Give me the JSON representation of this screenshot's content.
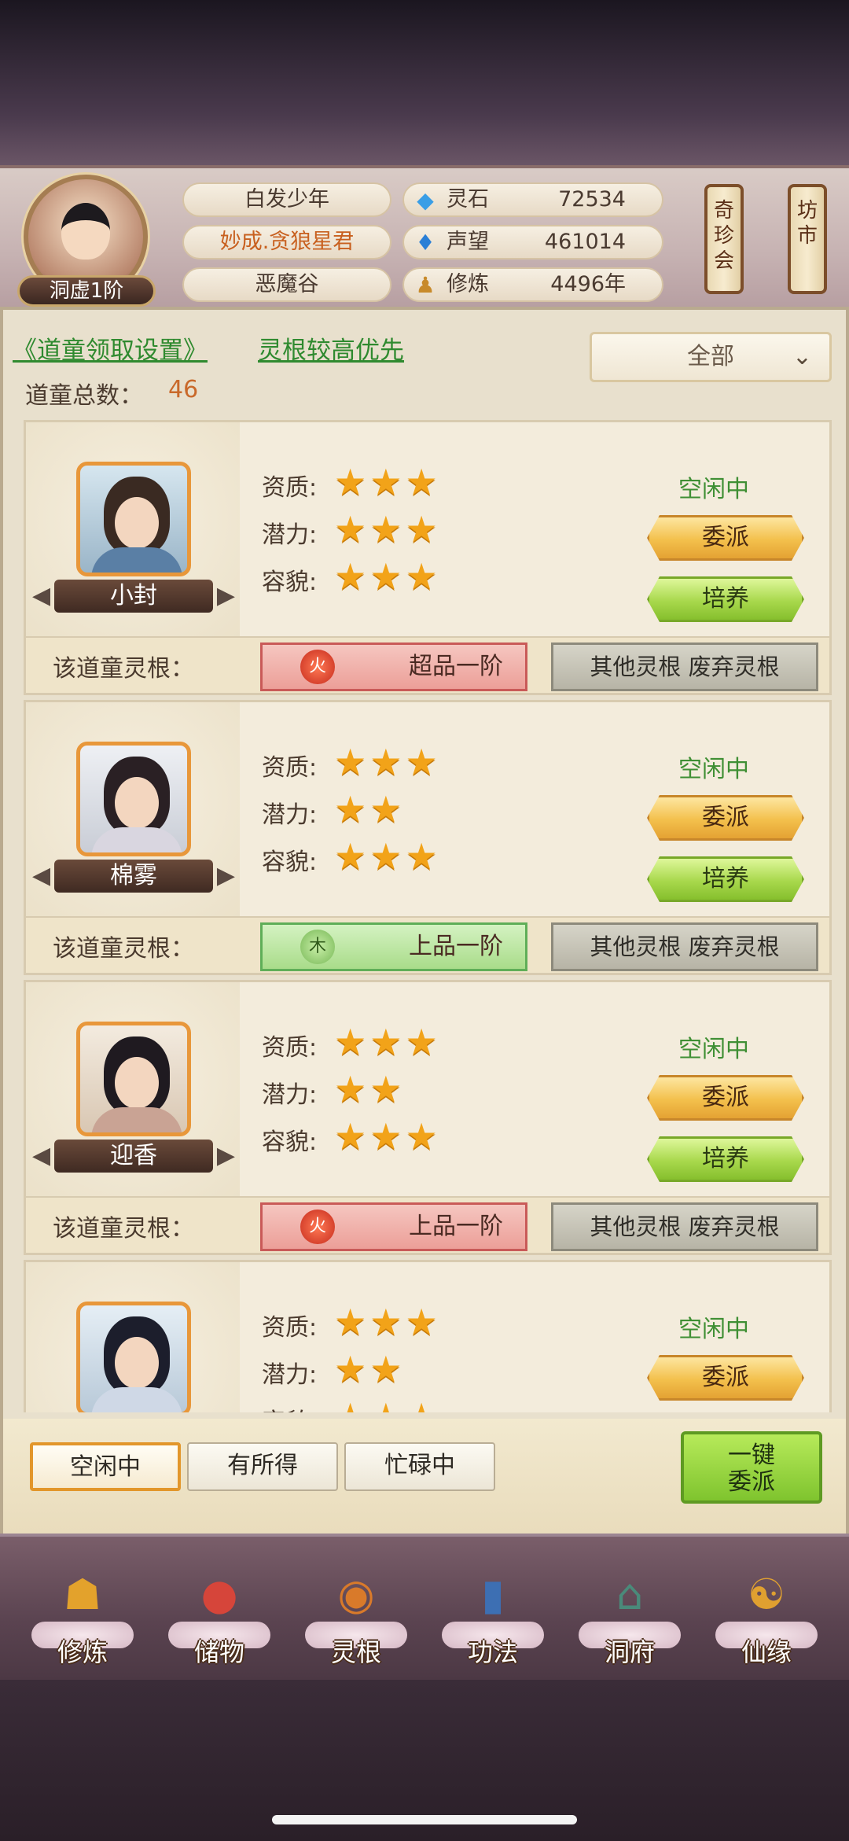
{
  "player": {
    "rank": "洞虚1阶",
    "name": "白发少年",
    "title": "妙成.贪狼星君",
    "location": "恶魔谷"
  },
  "resources": [
    {
      "icon": "spirit-stone-icon",
      "label": "灵石",
      "value": "72534"
    },
    {
      "icon": "reputation-icon",
      "label": "声望",
      "value": "461014"
    },
    {
      "icon": "cultivation-icon",
      "label": "修炼",
      "value": "4496年"
    }
  ],
  "side_buttons": {
    "treasure_hall": "奇珍会",
    "market": "坊市"
  },
  "settings": {
    "link_label": "《道童领取设置》",
    "priority_label": "灵根较高优先",
    "filter_selected": "全部",
    "total_label": "道童总数：",
    "total_value": "46"
  },
  "labels": {
    "aptitude": "资质:",
    "potential": "潜力:",
    "appearance": "容貌:",
    "root_label": "该道童灵根：",
    "assign": "委派",
    "train": "培养",
    "other_roots": "其他灵根 废弃灵根"
  },
  "servants": [
    {
      "name": "小封",
      "aptitude": 3,
      "potential": 3,
      "appearance": 3,
      "status": "空闲中",
      "root_element": "火",
      "root_grade": "超品一阶",
      "root_type": "fire"
    },
    {
      "name": "棉雾",
      "aptitude": 3,
      "potential": 2,
      "appearance": 3,
      "status": "空闲中",
      "root_element": "木",
      "root_grade": "上品一阶",
      "root_type": "wood"
    },
    {
      "name": "迎香",
      "aptitude": 3,
      "potential": 2,
      "appearance": 3,
      "status": "空闲中",
      "root_element": "火",
      "root_grade": "上品一阶",
      "root_type": "fire"
    },
    {
      "name": "",
      "aptitude": 3,
      "potential": 2,
      "appearance": 3,
      "status": "空闲中",
      "root_element": "",
      "root_grade": "",
      "root_type": "fire"
    }
  ],
  "filter_tabs": [
    {
      "label": "空闲中",
      "active": true
    },
    {
      "label": "有所得",
      "active": false
    },
    {
      "label": "忙碌中",
      "active": false
    }
  ],
  "one_click": {
    "line1": "一键",
    "line2": "委派"
  },
  "nav": [
    {
      "label": "修炼",
      "icon": "cultivate-icon"
    },
    {
      "label": "储物",
      "icon": "storage-bag-icon"
    },
    {
      "label": "灵根",
      "icon": "spirit-root-icon"
    },
    {
      "label": "功法",
      "icon": "technique-book-icon"
    },
    {
      "label": "洞府",
      "icon": "cave-mansion-icon"
    },
    {
      "label": "仙缘",
      "icon": "immortal-fate-icon"
    }
  ],
  "colors": {
    "accent_green": "#3f8f34",
    "accent_orange": "#c9692a",
    "star": "#f2a319"
  }
}
